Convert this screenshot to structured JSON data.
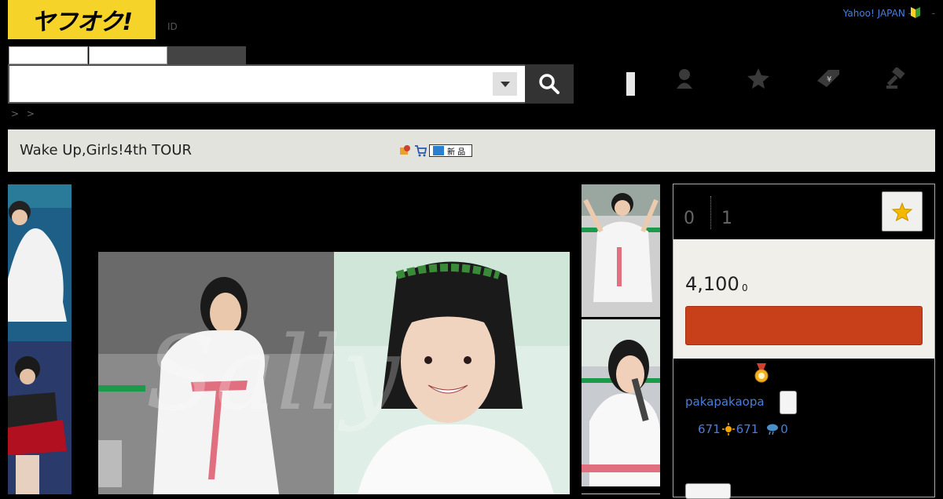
{
  "header": {
    "logo_text": "ヤフオク!",
    "login_id": "ID",
    "yahoo_link": "Yahoo! JAPAN",
    "sep": "-",
    "sep2": "-"
  },
  "search": {
    "placeholder": "",
    "value": ""
  },
  "breadcrumb": "> >",
  "item": {
    "title": "Wake Up,Girls!4th TOUR",
    "badge_new_label": "新 品"
  },
  "panel": {
    "count_left": "0",
    "count_right": "1",
    "price": "4,100",
    "price_tax": "0",
    "seller_name": "pakapakaopa",
    "rating_total": "671",
    "rating_good": "671",
    "rating_bad": "0"
  },
  "colors": {
    "logo_bg": "#f5d328",
    "bid_button": "#c8401a",
    "link": "#4a7ed8"
  },
  "icons": [
    "search-icon",
    "dropdown-icon",
    "user-icon",
    "star-icon",
    "tag-icon",
    "gavel-icon",
    "medal-icon",
    "sun-icon",
    "rain-icon",
    "cart-icon"
  ]
}
